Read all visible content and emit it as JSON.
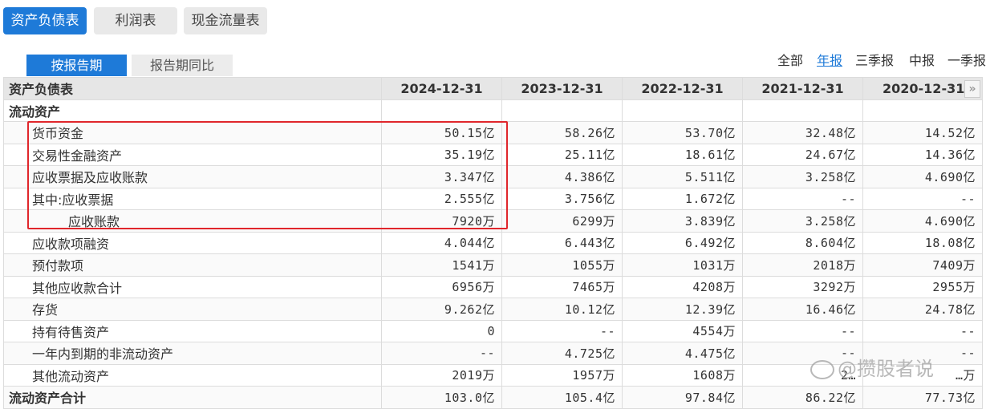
{
  "top_tabs": [
    {
      "label": "资产负债表",
      "active": true
    },
    {
      "label": "利润表",
      "active": false
    },
    {
      "label": "现金流量表",
      "active": false
    }
  ],
  "sub_tabs": [
    {
      "label": "按报告期",
      "active": true
    },
    {
      "label": "报告期同比",
      "active": false
    }
  ],
  "periods": [
    {
      "label": "全部",
      "active": false
    },
    {
      "label": "年报",
      "active": true
    },
    {
      "label": "三季报",
      "active": false
    },
    {
      "label": "中报",
      "active": false
    },
    {
      "label": "一季报",
      "active": false
    }
  ],
  "table": {
    "header_label": "资产负债表",
    "columns": [
      "2024-12-31",
      "2023-12-31",
      "2022-12-31",
      "2021-12-31",
      "2020-12-31"
    ],
    "scroll_glyph": "»",
    "rows": [
      {
        "label": "流动资产",
        "level": 0,
        "section": true,
        "values": [
          "",
          "",
          "",
          "",
          ""
        ]
      },
      {
        "label": "货币资金",
        "level": 1,
        "values": [
          "50.15亿",
          "58.26亿",
          "53.70亿",
          "32.48亿",
          "14.52亿"
        ]
      },
      {
        "label": "交易性金融资产",
        "level": 1,
        "values": [
          "35.19亿",
          "25.11亿",
          "18.61亿",
          "24.67亿",
          "14.36亿"
        ]
      },
      {
        "label": "应收票据及应收账款",
        "level": 1,
        "values": [
          "3.347亿",
          "4.386亿",
          "5.511亿",
          "3.258亿",
          "4.690亿"
        ]
      },
      {
        "label": "其中:应收票据",
        "level": 1,
        "values": [
          "2.555亿",
          "3.756亿",
          "1.672亿",
          "--",
          "--"
        ]
      },
      {
        "label": "应收账款",
        "level": 2,
        "values": [
          "7920万",
          "6299万",
          "3.839亿",
          "3.258亿",
          "4.690亿"
        ]
      },
      {
        "label": "应收款项融资",
        "level": 1,
        "values": [
          "4.044亿",
          "6.443亿",
          "6.492亿",
          "8.604亿",
          "18.08亿"
        ]
      },
      {
        "label": "预付款项",
        "level": 1,
        "values": [
          "1541万",
          "1055万",
          "1031万",
          "2018万",
          "7409万"
        ]
      },
      {
        "label": "其他应收款合计",
        "level": 1,
        "values": [
          "6956万",
          "7465万",
          "4208万",
          "3292万",
          "2955万"
        ]
      },
      {
        "label": "存货",
        "level": 1,
        "values": [
          "9.262亿",
          "10.12亿",
          "12.39亿",
          "16.46亿",
          "24.78亿"
        ]
      },
      {
        "label": "持有待售资产",
        "level": 1,
        "values": [
          "0",
          "--",
          "4554万",
          "--",
          "--"
        ]
      },
      {
        "label": "一年内到期的非流动资产",
        "level": 1,
        "values": [
          "--",
          "4.725亿",
          "4.475亿",
          "--",
          "--"
        ]
      },
      {
        "label": "其他流动资产",
        "level": 1,
        "values": [
          "2019万",
          "1957万",
          "1608万",
          "2…",
          "…万"
        ]
      },
      {
        "label": "流动资产合计",
        "level": 0,
        "section": true,
        "values": [
          "103.0亿",
          "105.4亿",
          "97.84亿",
          "86.22亿",
          "77.73亿"
        ]
      }
    ]
  },
  "watermark": "@攒股者说",
  "colors": {
    "accent": "#1e7ad8",
    "highlight_border": "#e0262b",
    "header_bg": "#e6e6e6"
  }
}
